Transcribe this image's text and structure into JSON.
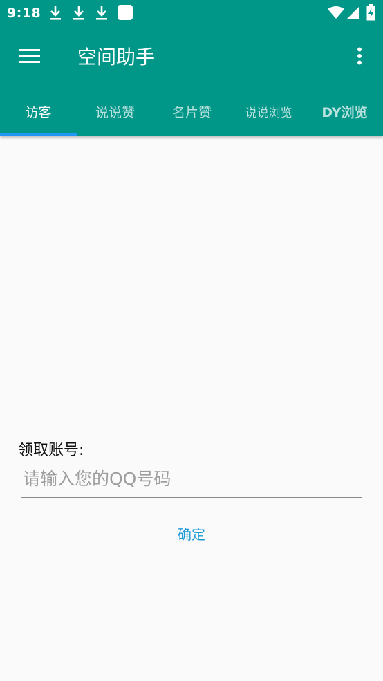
{
  "status_bar": {
    "time": "9:18",
    "icons": [
      "download-icon",
      "download-icon",
      "download-icon",
      "square-notification-icon",
      "wifi-icon",
      "signal-icon",
      "battery-charging-icon"
    ]
  },
  "app_bar": {
    "title": "空间助手",
    "menu_icon": "menu-icon",
    "more_icon": "more-vert-icon"
  },
  "tabs": [
    {
      "label": "访客",
      "active": true
    },
    {
      "label": "说说赞",
      "active": false
    },
    {
      "label": "名片赞",
      "active": false
    },
    {
      "label": "说说浏览",
      "active": false
    },
    {
      "label": "DY浏览",
      "active": false
    }
  ],
  "form": {
    "label": "领取账号:",
    "input_value": "",
    "input_placeholder": "请输入您的QQ号码",
    "confirm_label": "确定"
  },
  "colors": {
    "primary": "#009688",
    "tab_indicator": "#2196f3",
    "accent_text": "#1e9bd7",
    "background": "#fafafa"
  }
}
